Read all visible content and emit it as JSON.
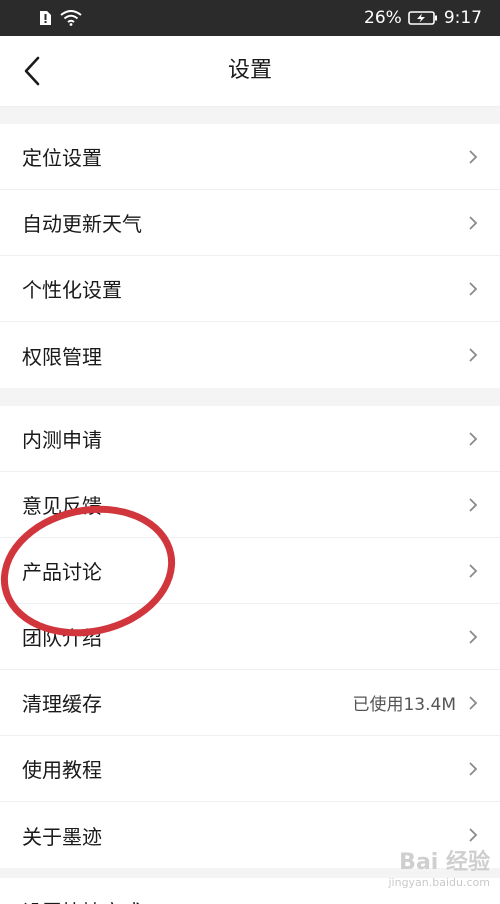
{
  "status_bar": {
    "battery_percent": "26%",
    "time": "9:17"
  },
  "header": {
    "title": "设置"
  },
  "group1": [
    {
      "label": "定位设置"
    },
    {
      "label": "自动更新天气"
    },
    {
      "label": "个性化设置"
    },
    {
      "label": "权限管理"
    }
  ],
  "group2": [
    {
      "label": "内测申请"
    },
    {
      "label": "意见反馈"
    },
    {
      "label": "产品讨论"
    },
    {
      "label": "团队介绍"
    },
    {
      "label": "清理缓存",
      "value": "已使用13.4M"
    },
    {
      "label": "使用教程"
    },
    {
      "label": "关于墨迹"
    }
  ],
  "group3_partial": [
    {
      "label": "设置快捷方式"
    }
  ],
  "watermark": {
    "logo_text": "Bai 经验",
    "url": "jingyan.baidu.com"
  },
  "colors": {
    "status_bar_bg": "#2b2b2b",
    "annotation_circle": "#d2363d"
  }
}
